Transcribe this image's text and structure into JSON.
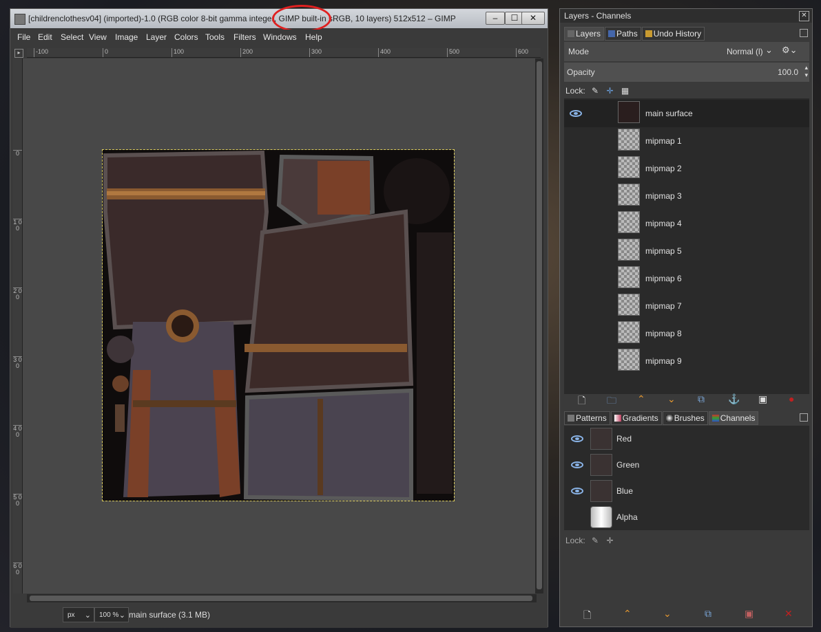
{
  "window": {
    "title": "[childrenclothesv04] (imported)-1.0 (RGB color 8-bit gamma integer, GIMP built-in sRGB, 10 layers) 512x512 – GIMP",
    "controls": [
      "–",
      "☐",
      "✕"
    ]
  },
  "menu": [
    "File",
    "Edit",
    "Select",
    "View",
    "Image",
    "Layer",
    "Colors",
    "Tools",
    "Filters",
    "Windows",
    "Help"
  ],
  "ruler": {
    "h_ticks": [
      "-100",
      "0",
      "100",
      "200",
      "300",
      "400",
      "500",
      "600"
    ],
    "v_ticks": [
      "0",
      "1 0 0",
      "2 0 0",
      "3 0 0",
      "4 0 0",
      "5 0 0",
      "6 0 0"
    ]
  },
  "status": {
    "unit": "px",
    "zoom": "100 %",
    "info": "main surface (3.1 MB)"
  },
  "dock": {
    "title": "Layers - Channels",
    "tabs": [
      "Layers",
      "Paths",
      "Undo History"
    ],
    "mode_label": "Mode",
    "mode_value": "Normal (l)",
    "opacity_label": "Opacity",
    "opacity_value": "100.0",
    "lock_label": "Lock:",
    "layers": [
      {
        "name": "main surface",
        "visible": true,
        "selected": true
      },
      {
        "name": "mipmap 1",
        "visible": false
      },
      {
        "name": "mipmap 2",
        "visible": false
      },
      {
        "name": "mipmap 3",
        "visible": false
      },
      {
        "name": "mipmap 4",
        "visible": false
      },
      {
        "name": "mipmap 5",
        "visible": false
      },
      {
        "name": "mipmap 6",
        "visible": false
      },
      {
        "name": "mipmap 7",
        "visible": false
      },
      {
        "name": "mipmap 8",
        "visible": false
      },
      {
        "name": "mipmap 9",
        "visible": false
      }
    ],
    "lower_tabs": [
      "Patterns",
      "Gradients",
      "Brushes",
      "Channels"
    ],
    "channels": [
      {
        "name": "Red",
        "visible": true
      },
      {
        "name": "Green",
        "visible": true
      },
      {
        "name": "Blue",
        "visible": true
      },
      {
        "name": "Alpha",
        "visible": false
      }
    ],
    "channel_lock_label": "Lock:"
  },
  "colors": {
    "highlight_circle": "#e02020",
    "selection_outline": "#e0d060",
    "eye_icon": "#8ab4e8"
  }
}
